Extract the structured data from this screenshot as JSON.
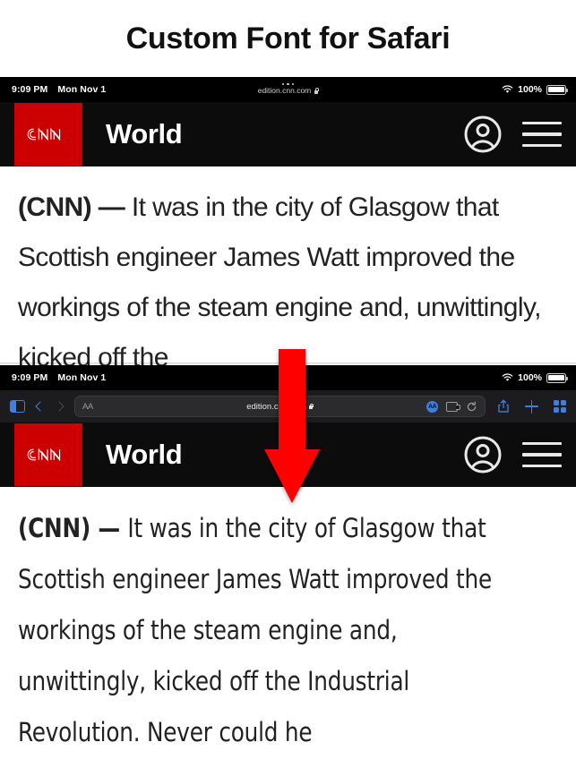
{
  "title": "Custom Font for Safari",
  "colors": {
    "accent_red": "#ff0000",
    "cnn_red": "#cc0000",
    "safari_blue": "#3f7fe0",
    "status_bar_bg": "#000000",
    "toolbar_bg": "#1c1c1e",
    "site_header_bg": "#0c0c0c"
  },
  "screenshot_top": {
    "status_bar": {
      "time": "9:09 PM",
      "date": "Mon Nov 1",
      "url": "edition.cnn.com",
      "lock_icon": "lock-icon",
      "wifi_icon": "wifi-icon",
      "battery_percent": "100%",
      "battery_icon": "battery-full-icon"
    },
    "site_header": {
      "logo_text": "CNN",
      "section": "World",
      "account_icon": "account-circle-icon",
      "menu_icon": "hamburger-menu-icon"
    },
    "article": {
      "lede": "(CNN) — ",
      "body": "It was in the city of Glasgow that Scottish engineer James Watt improved the workings of the steam engine and, unwittingly, kicked off the"
    }
  },
  "screenshot_bottom": {
    "status_bar": {
      "time": "9:09 PM",
      "date": "Mon Nov 1",
      "wifi_icon": "wifi-icon",
      "battery_percent": "100%",
      "battery_icon": "battery-full-icon"
    },
    "safari_toolbar": {
      "sidebar_icon": "sidebar-icon",
      "back_icon": "chevron-left-icon",
      "forward_icon": "chevron-right-icon",
      "text_size_label": "AA",
      "url": "edition.cnn.com",
      "lock_icon": "lock-icon",
      "reader_icon": "reader-mode-icon",
      "extensions_icon": "extensions-puzzle-icon",
      "reload_icon": "reload-icon",
      "share_icon": "share-icon",
      "new_tab_icon": "plus-icon",
      "tabs_icon": "tab-overview-icon"
    },
    "site_header": {
      "logo_text": "CNN",
      "section": "World",
      "account_icon": "account-circle-icon",
      "menu_icon": "hamburger-menu-icon"
    },
    "article": {
      "lede": "(CNN) — ",
      "body": "It was in the city of Glasgow that Scottish engineer James Watt improved the workings of the steam engine and, unwittingly, kicked off the Industrial Revolution. Never could he"
    }
  },
  "annotation": {
    "arrow_icon": "down-arrow-annotation",
    "direction": "down",
    "color": "#ff0000"
  }
}
